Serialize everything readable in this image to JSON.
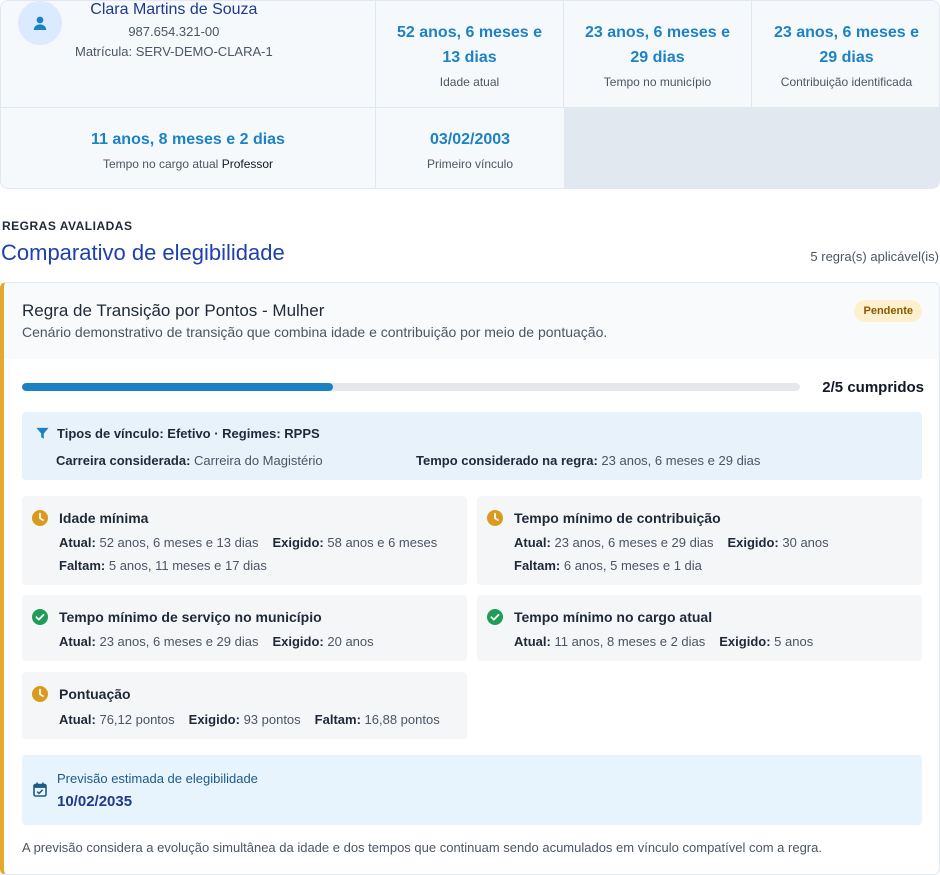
{
  "profile": {
    "name": "Clara Martins de Souza",
    "cpf": "987.654.321-00",
    "matricula_label": "Matrícula:",
    "matricula": "SERV-DEMO-CLARA-1"
  },
  "stats": {
    "idade": {
      "value_line1": "52 anos, 6 meses e",
      "value_line2": "13 dias",
      "label": "Idade atual"
    },
    "municipio": {
      "value_line1": "23 anos, 6 meses e",
      "value_line2": "29 dias",
      "label": "Tempo no município"
    },
    "contribuicao": {
      "value_line1": "23 anos, 6 meses e",
      "value_line2": "29 dias",
      "label": "Contribuição identificada"
    },
    "cargo": {
      "value": "11 anos, 8 meses e 2 dias",
      "label": "Tempo no cargo atual",
      "cargo_name": "Professor"
    },
    "vinculo": {
      "value": "03/02/2003",
      "label": "Primeiro vínculo"
    }
  },
  "section": {
    "overline": "REGRAS AVALIADAS",
    "title": "Comparativo de elegibilidade",
    "count": "5 regra(s) aplicável(is)"
  },
  "rule": {
    "title": "Regra de Transição por Pontos - Mulher",
    "description": "Cenário demonstrativo de transição que combina idade e contribuição por meio de pontuação.",
    "status": "Pendente",
    "status_color": "#e6a82c",
    "progress_fraction": 0.4,
    "progress_text": "2/5 cumpridos",
    "filter": {
      "types": "Tipos de vínculo: Efetivo · Regimes: RPPS",
      "career_label": "Carreira considerada:",
      "career": "Carreira do Magistério",
      "time_label": "Tempo considerado na regra:",
      "time": "23 anos, 6 meses e 29 dias"
    },
    "requirements": [
      {
        "title": "Idade mínima",
        "status": "pending",
        "atual": "52 anos, 6 meses e 13 dias",
        "exigido": "58 anos e 6 meses",
        "faltam": "5 anos, 11 meses e 17 dias"
      },
      {
        "title": "Tempo mínimo de contribuição",
        "status": "pending",
        "atual": "23 anos, 6 meses e 29 dias",
        "exigido": "30 anos",
        "faltam": "6 anos, 5 meses e 1 dia"
      },
      {
        "title": "Tempo mínimo de serviço no município",
        "status": "ok",
        "atual": "23 anos, 6 meses e 29 dias",
        "exigido": "20 anos"
      },
      {
        "title": "Tempo mínimo no cargo atual",
        "status": "ok",
        "atual": "11 anos, 8 meses e 2 dias",
        "exigido": "5 anos"
      },
      {
        "title": "Pontuação",
        "status": "pending",
        "atual": "76,12 pontos",
        "exigido": "93 pontos",
        "faltam": "16,88 pontos"
      }
    ],
    "labels": {
      "atual": "Atual:",
      "exigido": "Exigido:",
      "faltam": "Faltam:"
    },
    "forecast": {
      "label": "Previsão estimada de elegibilidade",
      "date": "10/02/2035"
    },
    "footnote": "A previsão considera a evolução simultânea da idade e dos tempos que continuam sendo acumulados em vínculo compatível com a regra."
  },
  "colors": {
    "accent": "#1d82c4",
    "pending": "#d99a1f",
    "ok": "#1f9d55"
  },
  "icons": {
    "avatar": "user-icon",
    "filter": "filter-icon",
    "pending": "clock-icon",
    "ok": "check-circle-icon",
    "forecast": "calendar-icon"
  }
}
